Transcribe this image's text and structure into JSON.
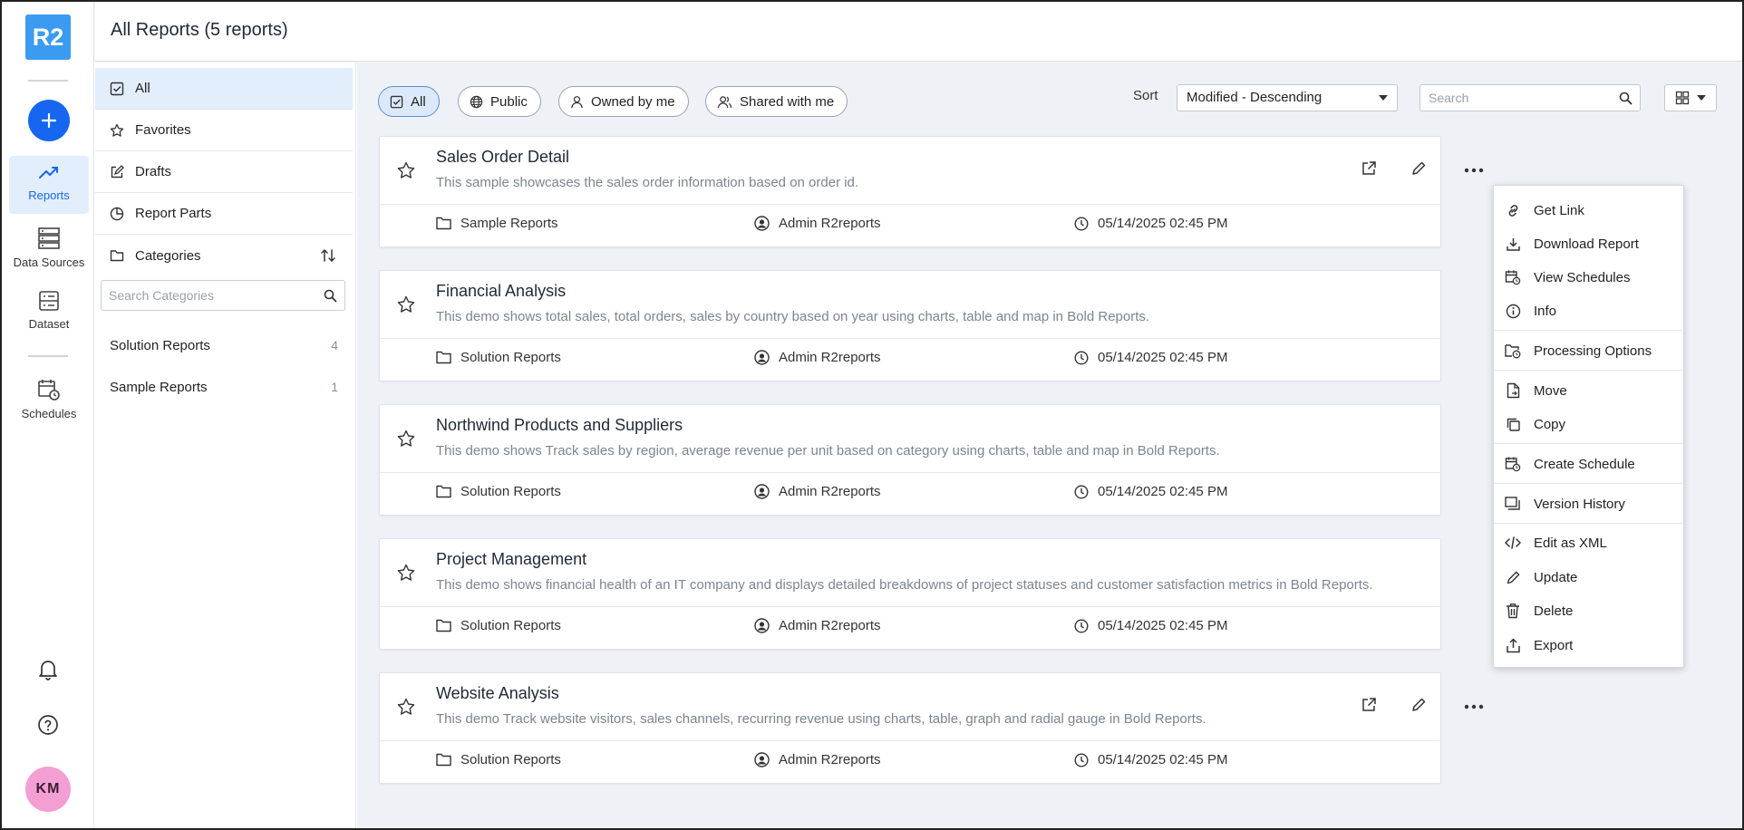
{
  "app": {
    "logo_text": "R2"
  },
  "header": {
    "title": "All Reports (5 reports)"
  },
  "rail": {
    "items": [
      {
        "label": "Reports",
        "icon": "trend-icon",
        "active": true
      },
      {
        "label": "Data Sources",
        "icon": "server-icon",
        "active": false
      },
      {
        "label": "Dataset",
        "icon": "dataset-icon",
        "active": false
      },
      {
        "label": "Schedules",
        "icon": "calendar-clock-icon",
        "active": false
      }
    ],
    "avatar": "KM"
  },
  "categories_panel": {
    "items": [
      {
        "label": "All",
        "icon": "checkbox-icon",
        "active": true
      },
      {
        "label": "Favorites",
        "icon": "star-icon"
      },
      {
        "label": "Drafts",
        "icon": "edit-square-icon"
      },
      {
        "label": "Report Parts",
        "icon": "pie-icon"
      },
      {
        "label": "Categories",
        "icon": "folder-icon"
      }
    ],
    "search_placeholder": "Search Categories",
    "categories": [
      {
        "label": "Solution Reports",
        "count": "4"
      },
      {
        "label": "Sample Reports",
        "count": "1"
      }
    ]
  },
  "toolbar": {
    "filters": [
      {
        "label": "All",
        "icon": "checkbox-icon",
        "active": true
      },
      {
        "label": "Public",
        "icon": "globe-icon"
      },
      {
        "label": "Owned by me",
        "icon": "user-icon"
      },
      {
        "label": "Shared with me",
        "icon": "users-icon"
      }
    ],
    "sort_label": "Sort",
    "sort_value": "Modified - Descending",
    "search_placeholder": "Search"
  },
  "reports": [
    {
      "title": "Sales Order Detail",
      "description": "This sample showcases the sales order information based on order id.",
      "category": "Sample Reports",
      "owner": "Admin R2reports",
      "modified": "05/14/2025 02:45 PM"
    },
    {
      "title": "Financial Analysis",
      "description": "This demo shows total sales, total orders, sales by country based on year using charts, table and map in Bold Reports.",
      "category": "Solution Reports",
      "owner": "Admin R2reports",
      "modified": "05/14/2025 02:45 PM"
    },
    {
      "title": "Northwind Products and Suppliers",
      "description": "This demo shows Track sales by region, average revenue per unit based on category using charts, table and map in Bold Reports.",
      "category": "Solution Reports",
      "owner": "Admin R2reports",
      "modified": "05/14/2025 02:45 PM"
    },
    {
      "title": "Project Management",
      "description": "This demo shows financial health of an IT company and displays detailed breakdowns of project statuses and customer satisfaction metrics in Bold Reports.",
      "category": "Solution Reports",
      "owner": "Admin R2reports",
      "modified": "05/14/2025 02:45 PM"
    },
    {
      "title": "Website Analysis",
      "description": "This demo Track website visitors, sales channels, recurring revenue using charts, table, graph and radial gauge in Bold Reports.",
      "category": "Solution Reports",
      "owner": "Admin R2reports",
      "modified": "05/14/2025 02:45 PM"
    }
  ],
  "context_menu": {
    "items": [
      {
        "label": "Get Link",
        "icon": "link-icon"
      },
      {
        "label": "Download Report",
        "icon": "download-icon"
      },
      {
        "label": "View Schedules",
        "icon": "calendar-clock-icon"
      },
      {
        "label": "Info",
        "icon": "info-icon"
      },
      {
        "label": "Processing Options",
        "icon": "folder-clock-icon"
      },
      {
        "label": "Move",
        "icon": "move-icon"
      },
      {
        "label": "Copy",
        "icon": "copy-icon"
      },
      {
        "label": "Create Schedule",
        "icon": "calendar-clock-icon"
      },
      {
        "label": "Version History",
        "icon": "versions-icon"
      },
      {
        "label": "Edit as XML",
        "icon": "code-icon"
      },
      {
        "label": "Update",
        "icon": "pencil-icon"
      },
      {
        "label": "Delete",
        "icon": "trash-icon"
      },
      {
        "label": "Export",
        "icon": "export-icon"
      }
    ]
  },
  "colors": {
    "accent": "#1766f0",
    "logo": "#3b9bf0",
    "active_bg": "#e3eefc",
    "avatar": "#f49fd4"
  }
}
